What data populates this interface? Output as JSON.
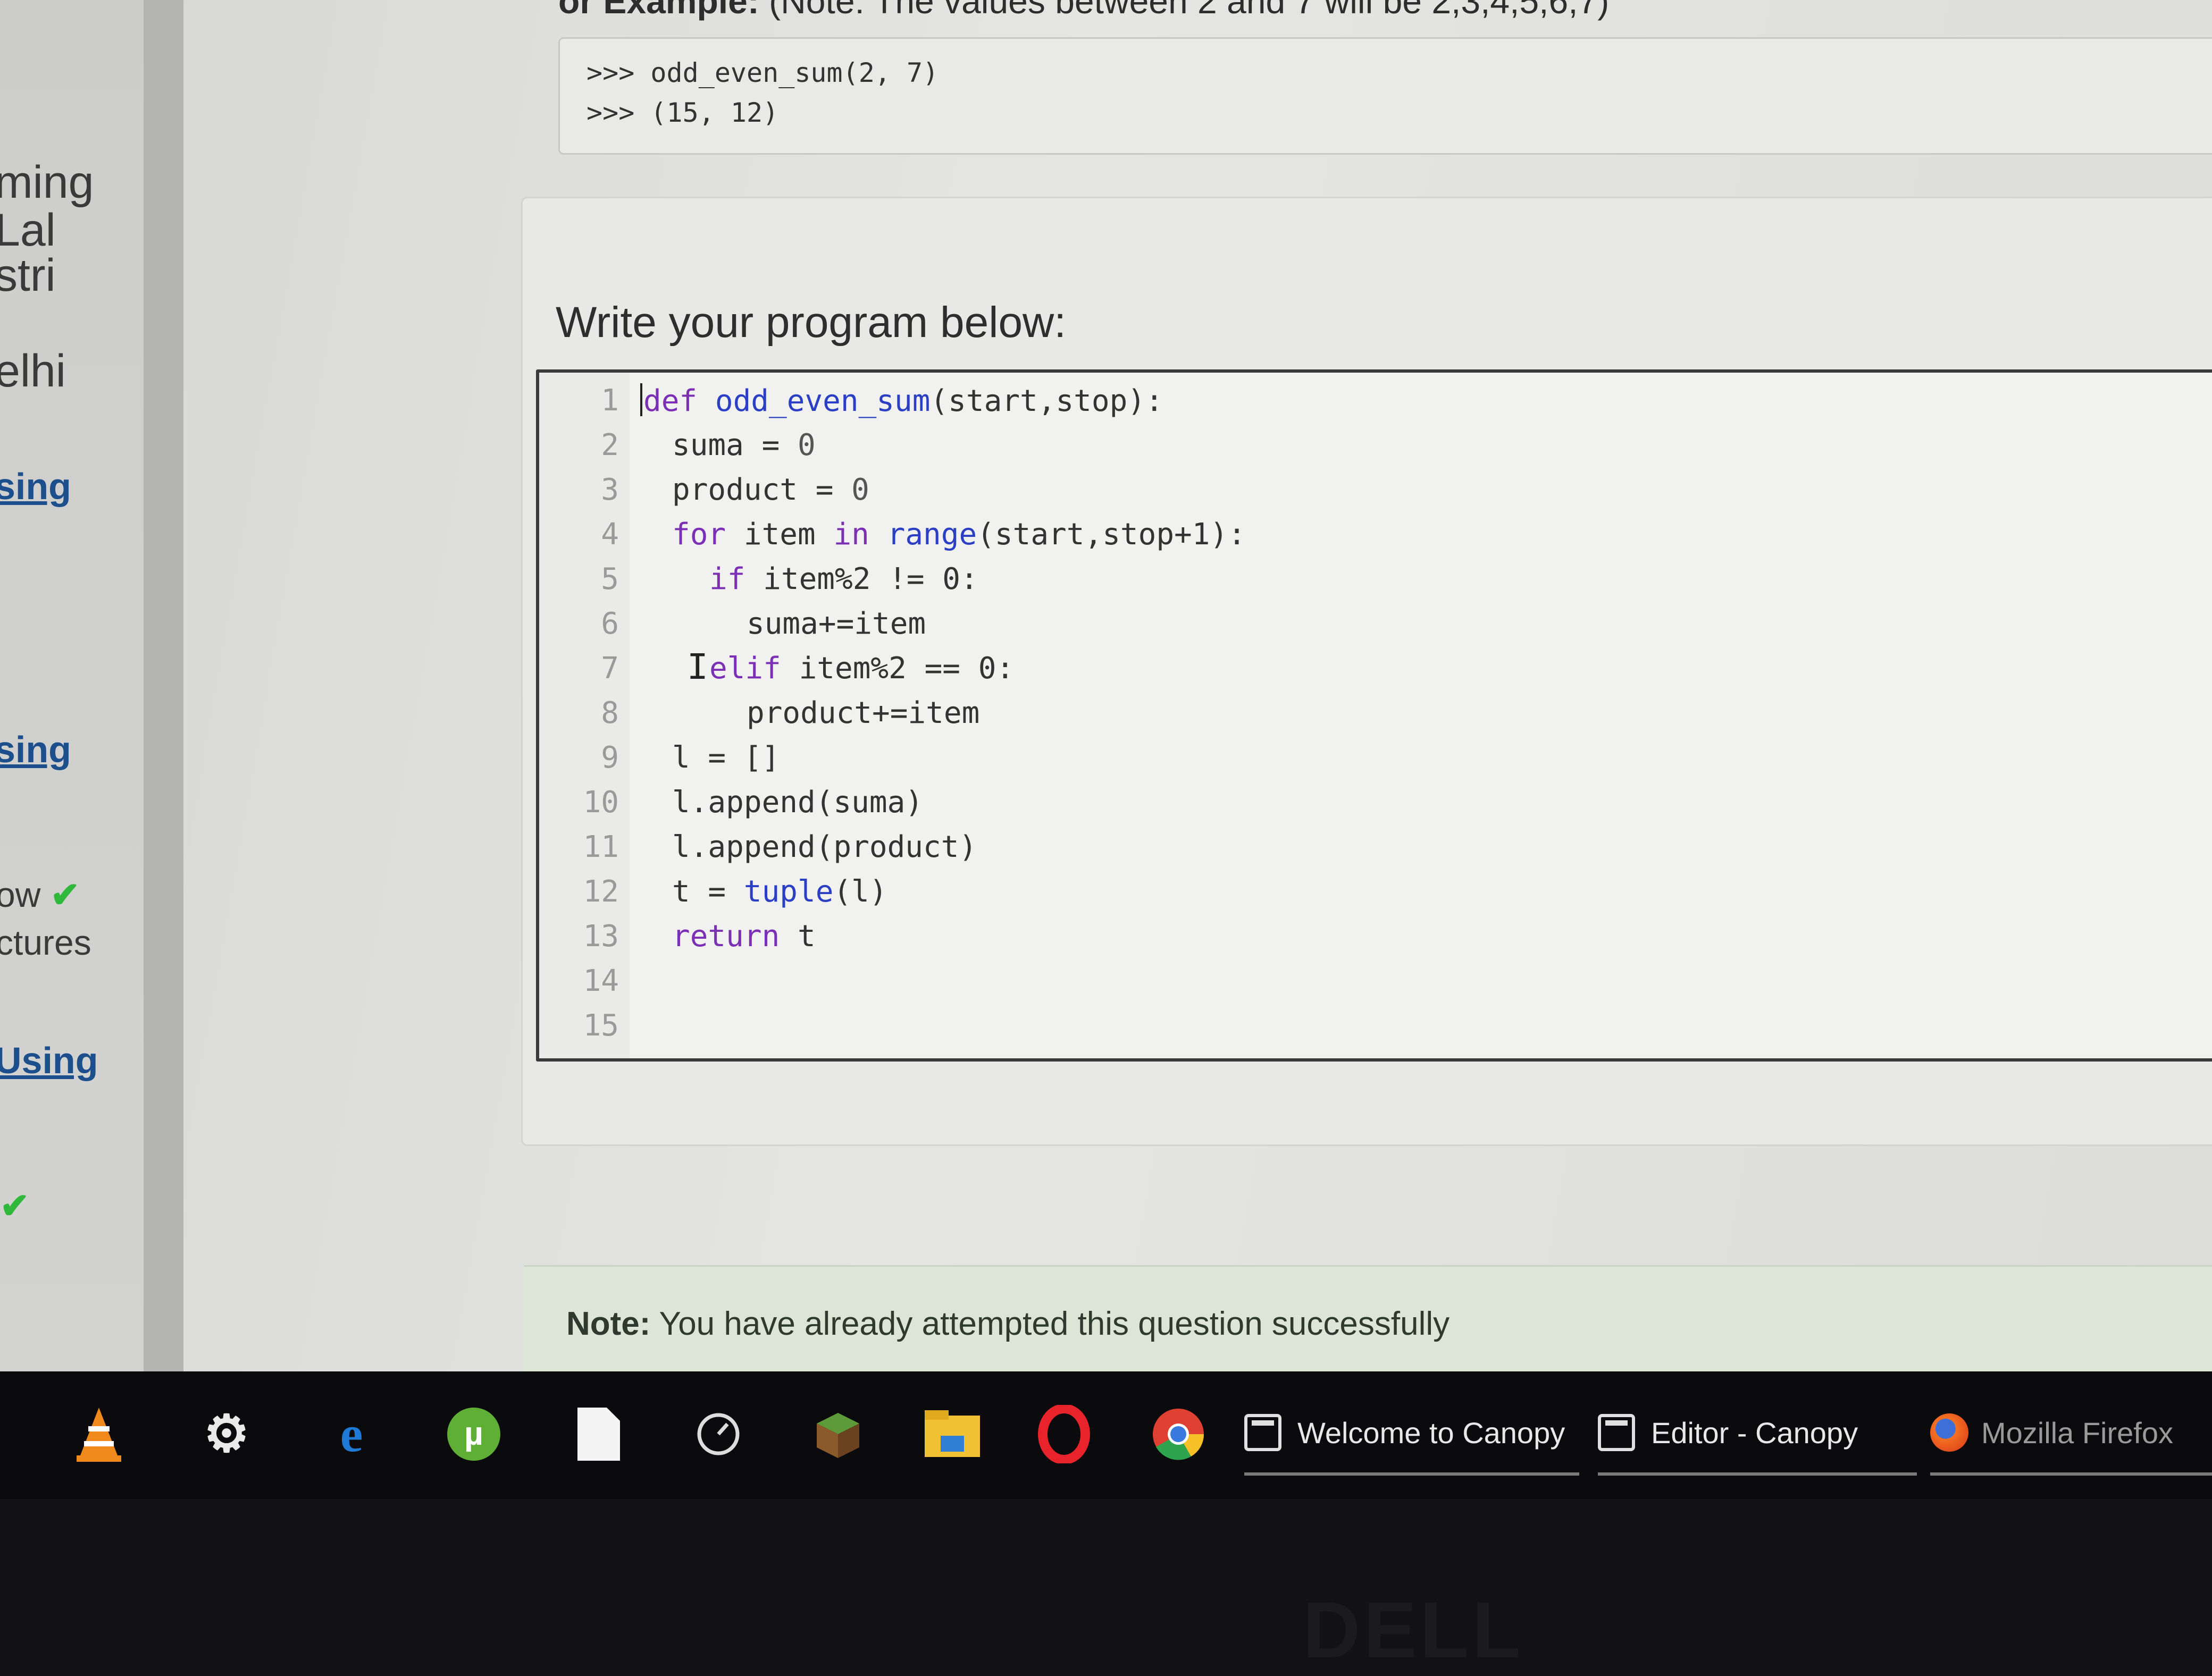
{
  "example": {
    "heading_bold": "or Example:",
    "heading_rest": " (Note: The values between 2 and 7 will be 2,3,4,5,6,7)",
    "lines": [
      ">>> odd_even_sum(2, 7)",
      ">>> (15, 12)"
    ]
  },
  "sidebar": {
    "text_lines": [
      "ming",
      "Lal",
      "stri",
      "elhi"
    ],
    "links": [
      "sing",
      "sing",
      "Using"
    ],
    "items": [
      "ow",
      "ctures"
    ]
  },
  "prompt_label": "Write your program below:",
  "editor": {
    "line_numbers": [
      "1",
      "2",
      "3",
      "4",
      "5",
      "6",
      "7",
      "8",
      "9",
      "10",
      "11",
      "12",
      "13",
      "14",
      "15"
    ],
    "line_14": "",
    "line_15": ""
  },
  "note": {
    "label": "Note:",
    "message": " You have already attempted this question successfully"
  },
  "taskbar": {
    "pinned": [
      "vlc-icon",
      "gear-icon",
      "edge-icon",
      "utorrent-icon",
      "file-icon",
      "speed-icon",
      "minecraft-icon",
      "file-explorer-icon",
      "opera-icon",
      "chrome-icon"
    ],
    "tasks": [
      "Welcome to Canopy",
      "Editor - Canopy",
      "Mozilla Firefox"
    ]
  },
  "monitor_brand": "DELL",
  "colors": {
    "keyword": "#7a2fb5",
    "function": "#2b3fc4",
    "link": "#1c4f8c",
    "check": "#2fb83a"
  }
}
